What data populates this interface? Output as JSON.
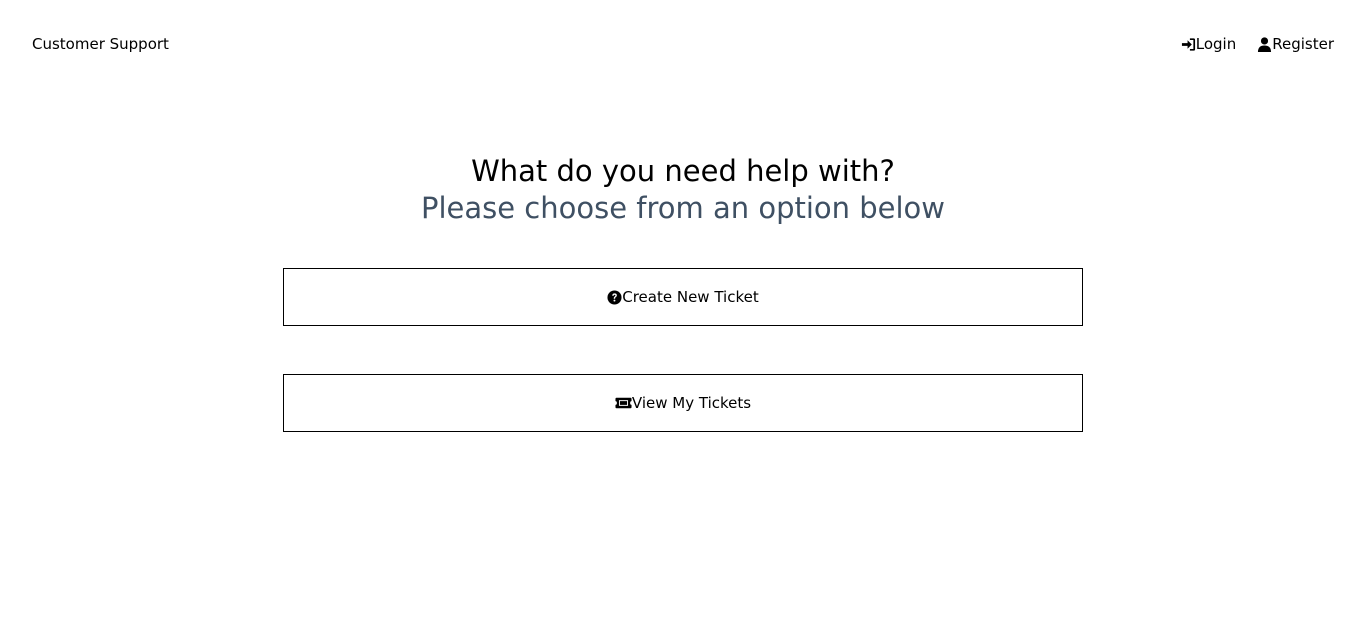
{
  "header": {
    "brand": "Customer Support",
    "nav": [
      {
        "label": "Login",
        "icon": "sign-in-icon"
      },
      {
        "label": "Register",
        "icon": "user-icon"
      }
    ]
  },
  "hero": {
    "title": "What do you need help with?",
    "subtitle": "Please choose from an option below",
    "subtitle_color": "#3f5063"
  },
  "actions": {
    "create": {
      "label": "Create New Ticket",
      "icon": "question-circle-icon"
    },
    "view": {
      "label": "View My Tickets",
      "icon": "ticket-icon"
    }
  }
}
